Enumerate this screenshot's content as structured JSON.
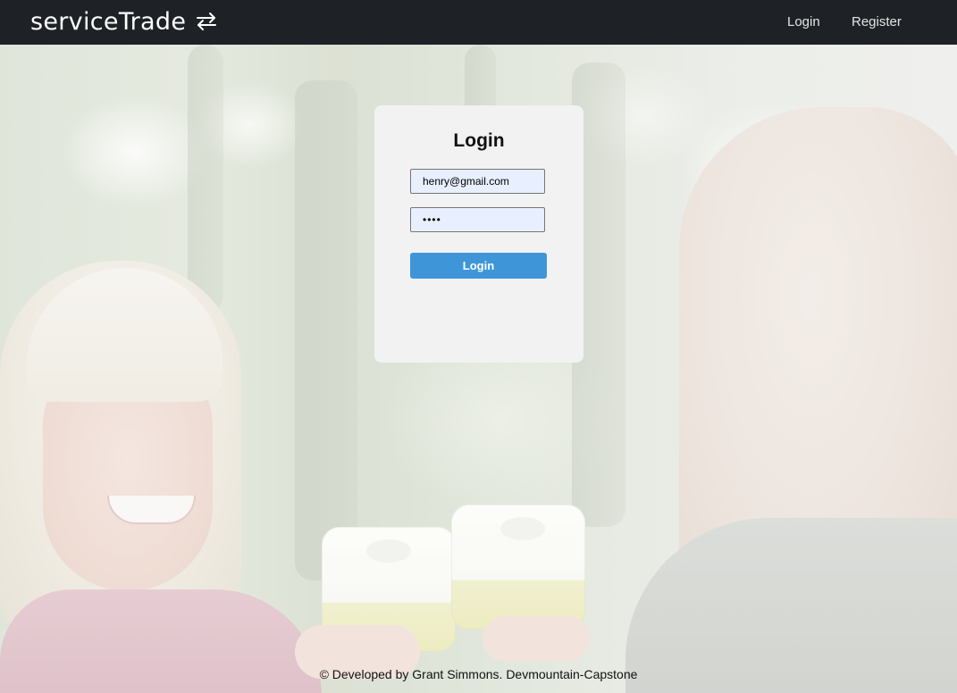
{
  "navbar": {
    "brand": "serviceTrade",
    "brand_icon": "swap-arrows-icon",
    "links": [
      {
        "label": "Login"
      },
      {
        "label": "Register"
      }
    ]
  },
  "login_card": {
    "title": "Login",
    "email_value": "henry@gmail.com",
    "password_value": "••••",
    "submit_label": "Login"
  },
  "footer": {
    "text": "© Developed by Grant Simmons. Devmountain-Capstone"
  },
  "colors": {
    "navbar_bg": "#1e2125",
    "card_bg": "#f2f2f2",
    "button_bg": "#3e96d8",
    "input_bg": "#e8effe"
  }
}
